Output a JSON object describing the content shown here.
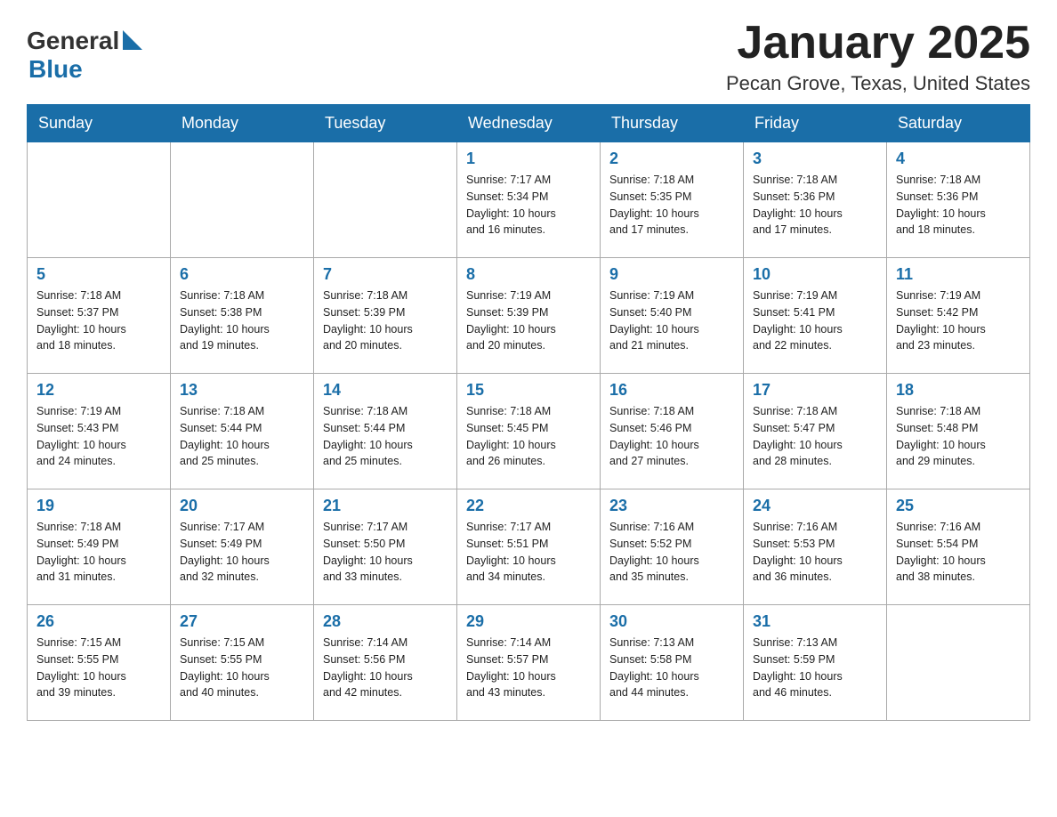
{
  "header": {
    "logo_general": "General",
    "logo_blue": "Blue",
    "month": "January 2025",
    "location": "Pecan Grove, Texas, United States"
  },
  "weekdays": [
    "Sunday",
    "Monday",
    "Tuesday",
    "Wednesday",
    "Thursday",
    "Friday",
    "Saturday"
  ],
  "weeks": [
    [
      {
        "day": "",
        "info": ""
      },
      {
        "day": "",
        "info": ""
      },
      {
        "day": "",
        "info": ""
      },
      {
        "day": "1",
        "info": "Sunrise: 7:17 AM\nSunset: 5:34 PM\nDaylight: 10 hours\nand 16 minutes."
      },
      {
        "day": "2",
        "info": "Sunrise: 7:18 AM\nSunset: 5:35 PM\nDaylight: 10 hours\nand 17 minutes."
      },
      {
        "day": "3",
        "info": "Sunrise: 7:18 AM\nSunset: 5:36 PM\nDaylight: 10 hours\nand 17 minutes."
      },
      {
        "day": "4",
        "info": "Sunrise: 7:18 AM\nSunset: 5:36 PM\nDaylight: 10 hours\nand 18 minutes."
      }
    ],
    [
      {
        "day": "5",
        "info": "Sunrise: 7:18 AM\nSunset: 5:37 PM\nDaylight: 10 hours\nand 18 minutes."
      },
      {
        "day": "6",
        "info": "Sunrise: 7:18 AM\nSunset: 5:38 PM\nDaylight: 10 hours\nand 19 minutes."
      },
      {
        "day": "7",
        "info": "Sunrise: 7:18 AM\nSunset: 5:39 PM\nDaylight: 10 hours\nand 20 minutes."
      },
      {
        "day": "8",
        "info": "Sunrise: 7:19 AM\nSunset: 5:39 PM\nDaylight: 10 hours\nand 20 minutes."
      },
      {
        "day": "9",
        "info": "Sunrise: 7:19 AM\nSunset: 5:40 PM\nDaylight: 10 hours\nand 21 minutes."
      },
      {
        "day": "10",
        "info": "Sunrise: 7:19 AM\nSunset: 5:41 PM\nDaylight: 10 hours\nand 22 minutes."
      },
      {
        "day": "11",
        "info": "Sunrise: 7:19 AM\nSunset: 5:42 PM\nDaylight: 10 hours\nand 23 minutes."
      }
    ],
    [
      {
        "day": "12",
        "info": "Sunrise: 7:19 AM\nSunset: 5:43 PM\nDaylight: 10 hours\nand 24 minutes."
      },
      {
        "day": "13",
        "info": "Sunrise: 7:18 AM\nSunset: 5:44 PM\nDaylight: 10 hours\nand 25 minutes."
      },
      {
        "day": "14",
        "info": "Sunrise: 7:18 AM\nSunset: 5:44 PM\nDaylight: 10 hours\nand 25 minutes."
      },
      {
        "day": "15",
        "info": "Sunrise: 7:18 AM\nSunset: 5:45 PM\nDaylight: 10 hours\nand 26 minutes."
      },
      {
        "day": "16",
        "info": "Sunrise: 7:18 AM\nSunset: 5:46 PM\nDaylight: 10 hours\nand 27 minutes."
      },
      {
        "day": "17",
        "info": "Sunrise: 7:18 AM\nSunset: 5:47 PM\nDaylight: 10 hours\nand 28 minutes."
      },
      {
        "day": "18",
        "info": "Sunrise: 7:18 AM\nSunset: 5:48 PM\nDaylight: 10 hours\nand 29 minutes."
      }
    ],
    [
      {
        "day": "19",
        "info": "Sunrise: 7:18 AM\nSunset: 5:49 PM\nDaylight: 10 hours\nand 31 minutes."
      },
      {
        "day": "20",
        "info": "Sunrise: 7:17 AM\nSunset: 5:49 PM\nDaylight: 10 hours\nand 32 minutes."
      },
      {
        "day": "21",
        "info": "Sunrise: 7:17 AM\nSunset: 5:50 PM\nDaylight: 10 hours\nand 33 minutes."
      },
      {
        "day": "22",
        "info": "Sunrise: 7:17 AM\nSunset: 5:51 PM\nDaylight: 10 hours\nand 34 minutes."
      },
      {
        "day": "23",
        "info": "Sunrise: 7:16 AM\nSunset: 5:52 PM\nDaylight: 10 hours\nand 35 minutes."
      },
      {
        "day": "24",
        "info": "Sunrise: 7:16 AM\nSunset: 5:53 PM\nDaylight: 10 hours\nand 36 minutes."
      },
      {
        "day": "25",
        "info": "Sunrise: 7:16 AM\nSunset: 5:54 PM\nDaylight: 10 hours\nand 38 minutes."
      }
    ],
    [
      {
        "day": "26",
        "info": "Sunrise: 7:15 AM\nSunset: 5:55 PM\nDaylight: 10 hours\nand 39 minutes."
      },
      {
        "day": "27",
        "info": "Sunrise: 7:15 AM\nSunset: 5:55 PM\nDaylight: 10 hours\nand 40 minutes."
      },
      {
        "day": "28",
        "info": "Sunrise: 7:14 AM\nSunset: 5:56 PM\nDaylight: 10 hours\nand 42 minutes."
      },
      {
        "day": "29",
        "info": "Sunrise: 7:14 AM\nSunset: 5:57 PM\nDaylight: 10 hours\nand 43 minutes."
      },
      {
        "day": "30",
        "info": "Sunrise: 7:13 AM\nSunset: 5:58 PM\nDaylight: 10 hours\nand 44 minutes."
      },
      {
        "day": "31",
        "info": "Sunrise: 7:13 AM\nSunset: 5:59 PM\nDaylight: 10 hours\nand 46 minutes."
      },
      {
        "day": "",
        "info": ""
      }
    ]
  ]
}
